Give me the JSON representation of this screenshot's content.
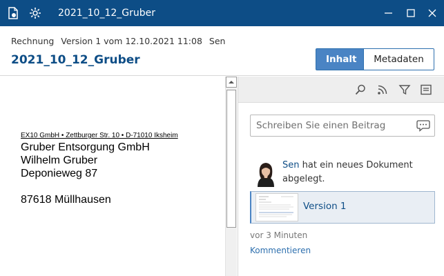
{
  "window": {
    "title": "2021_10_12_Gruber",
    "icons": [
      "document-app-icon",
      "settings-icon"
    ],
    "controls": [
      "minimize-icon",
      "maximize-icon",
      "close-icon"
    ]
  },
  "header": {
    "doc_type": "Rechnung",
    "version_info": "Version 1 vom 12.10.2021 11:08",
    "author": "Sen",
    "title": "2021_10_12_Gruber",
    "tabs": {
      "content": "Inhalt",
      "metadata": "Metadaten",
      "active": "content"
    }
  },
  "preview": {
    "sender_line": "EX10 GmbH • Zettburger Str. 10 • D-71010 Iksheim",
    "address_lines": [
      "Gruber Entsorgung GmbH",
      "Wilhelm Gruber",
      "Deponieweg 87",
      "87618 Müllhausen"
    ]
  },
  "feed": {
    "toolbar_icons": [
      "search-icon",
      "rss-feed-icon",
      "filter-icon",
      "list-view-icon"
    ],
    "post_placeholder": "Schreiben Sie einen Beitrag",
    "activity": {
      "user": "Sen",
      "text": "hat ein neues Dokument abgelegt."
    },
    "version_card_label": "Version 1",
    "time_ago": "vor 3 Minuten",
    "comment_link": "Kommentieren"
  },
  "colors": {
    "titlebar": "#0d4d86",
    "accent": "#4a84c4",
    "link": "#2d6fae"
  }
}
